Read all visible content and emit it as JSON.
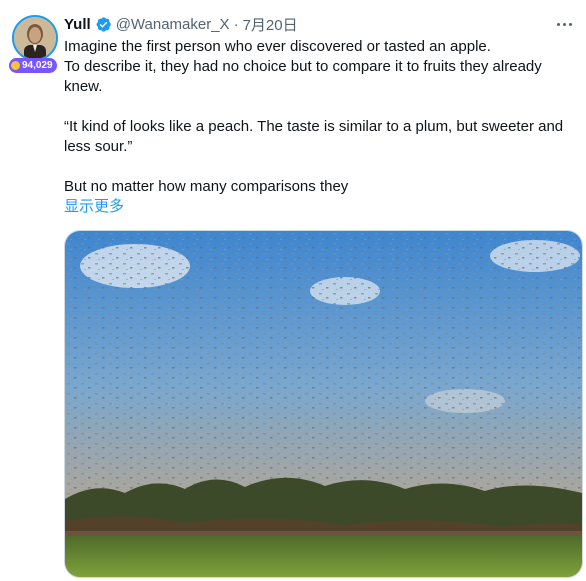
{
  "author": {
    "name": "Yull",
    "handle": "@Wanamaker_X",
    "separator": "·",
    "date": "7月20日",
    "badge_count": "94,029"
  },
  "tweet": {
    "line1": "Imagine the first person who ever discovered or tasted an apple.",
    "line2": "To describe it, they had no choice but to compare it to fruits they already knew.",
    "quote": "“It kind of looks like a peach. The taste is similar to a plum, but sweeter and less sour.”",
    "line3": "But no matter how many comparisons they",
    "show_more": "显示更多"
  },
  "icons": {
    "verified": "verified-badge-icon",
    "more": "more-options-icon"
  },
  "colors": {
    "accent": "#1d9bf0",
    "secondary_text": "#536471",
    "badge_bg": "#7856ff"
  }
}
